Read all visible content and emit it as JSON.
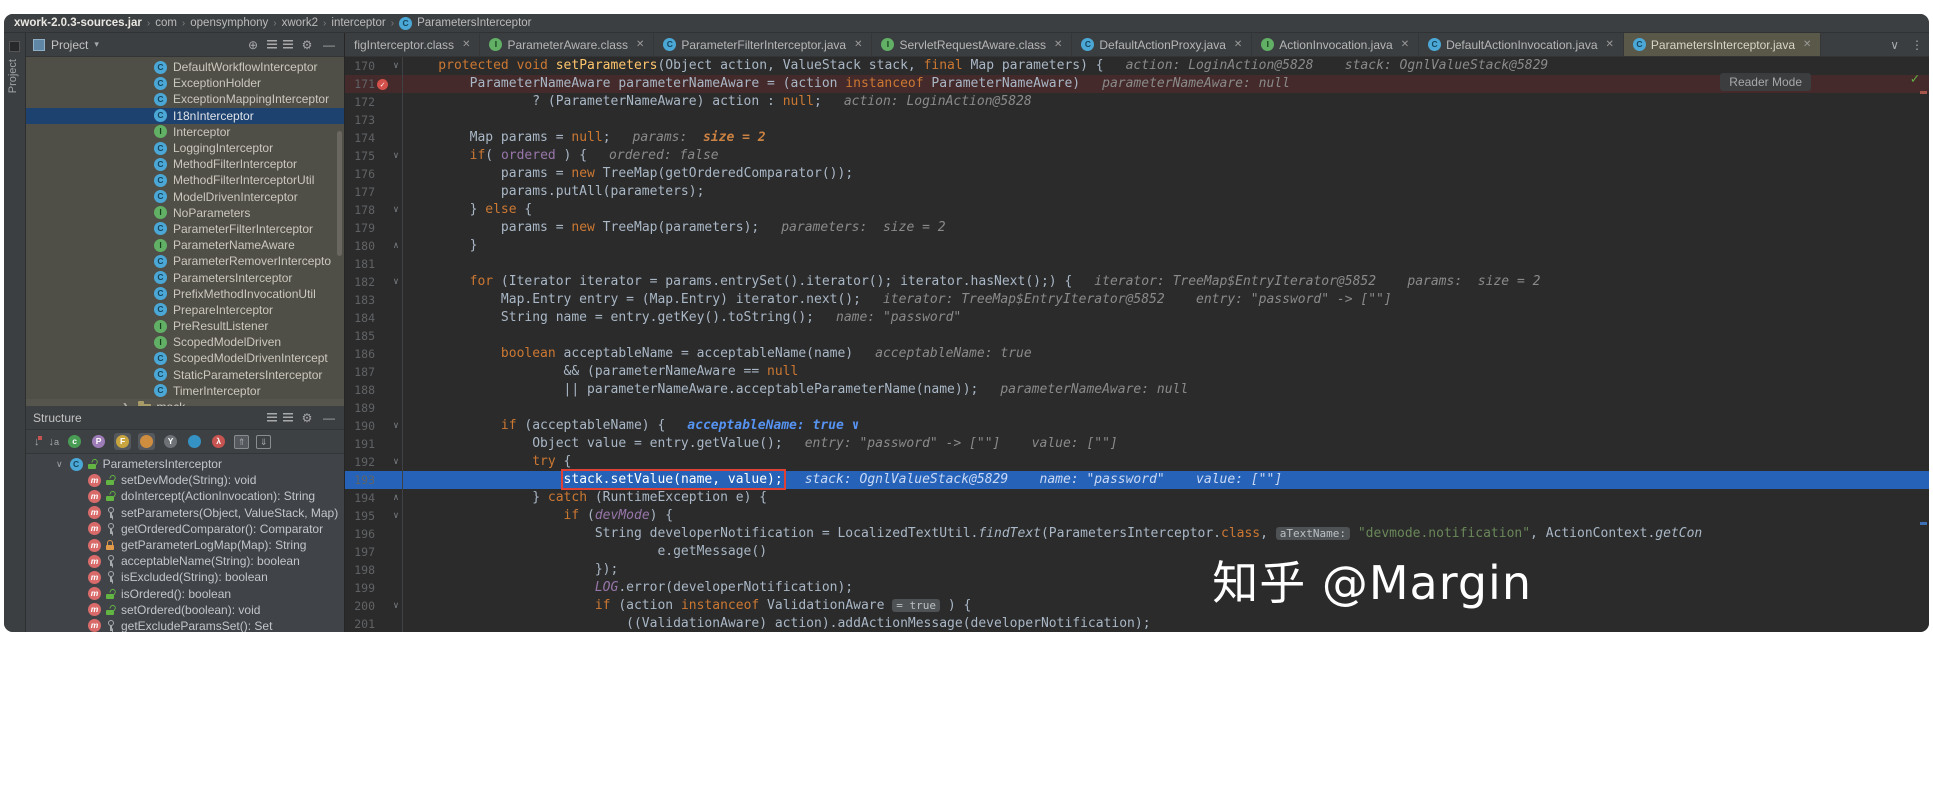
{
  "colors": {
    "editor_bg": "#2b2b2b",
    "panel_bg": "#3c3f41",
    "project_tree_bg": "#504f47",
    "selection_blue": "#1d4270",
    "execution_line": "#2663b8",
    "breakpoint_line": "#442a2a",
    "breakpoint_red": "#d3514a",
    "annotation_red": "#e03f34",
    "keyword_orange": "#cc7832",
    "string_green": "#6a8759",
    "hint_gray": "#8a8a8a",
    "hint_blue": "#5693f2",
    "check_green": "#62b543"
  },
  "breadcrumb": {
    "items": [
      "xwork-2.0.3-sources.jar",
      "com",
      "opensymphony",
      "xwork2",
      "interceptor",
      "ParametersInterceptor"
    ]
  },
  "window": {
    "reader_mode": "Reader Mode",
    "watermark": "知乎 @Margin"
  },
  "project_panel": {
    "tool_label": "Project",
    "title": "Project",
    "mock_folder": "mock",
    "items": [
      {
        "label": "DefaultWorkflowInterceptor",
        "icon": "class"
      },
      {
        "label": "ExceptionHolder",
        "icon": "class"
      },
      {
        "label": "ExceptionMappingInterceptor",
        "icon": "class"
      },
      {
        "label": "I18nInterceptor",
        "icon": "class",
        "selected": true
      },
      {
        "label": "Interceptor",
        "icon": "interface"
      },
      {
        "label": "LoggingInterceptor",
        "icon": "class"
      },
      {
        "label": "MethodFilterInterceptor",
        "icon": "class"
      },
      {
        "label": "MethodFilterInterceptorUtil",
        "icon": "class"
      },
      {
        "label": "ModelDrivenInterceptor",
        "icon": "class"
      },
      {
        "label": "NoParameters",
        "icon": "interface"
      },
      {
        "label": "ParameterFilterInterceptor",
        "icon": "class"
      },
      {
        "label": "ParameterNameAware",
        "icon": "interface"
      },
      {
        "label": "ParameterRemoverIntercepto",
        "icon": "class"
      },
      {
        "label": "ParametersInterceptor",
        "icon": "class"
      },
      {
        "label": "PrefixMethodInvocationUtil",
        "icon": "class"
      },
      {
        "label": "PrepareInterceptor",
        "icon": "class"
      },
      {
        "label": "PreResultListener",
        "icon": "interface"
      },
      {
        "label": "ScopedModelDriven",
        "icon": "interface"
      },
      {
        "label": "ScopedModelDrivenIntercept",
        "icon": "class"
      },
      {
        "label": "StaticParametersInterceptor",
        "icon": "class"
      },
      {
        "label": "TimerInterceptor",
        "icon": "class"
      }
    ]
  },
  "structure_panel": {
    "title": "Structure",
    "root": "ParametersInterceptor",
    "items": [
      {
        "label": "setDevMode(String): void",
        "visibility": "public"
      },
      {
        "label": "doIntercept(ActionInvocation): String",
        "visibility": "public"
      },
      {
        "label": "setParameters(Object, ValueStack, Map)",
        "visibility": "protected"
      },
      {
        "label": "getOrderedComparator(): Comparator",
        "visibility": "protected"
      },
      {
        "label": "getParameterLogMap(Map): String",
        "visibility": "private"
      },
      {
        "label": "acceptableName(String): boolean",
        "visibility": "protected"
      },
      {
        "label": "isExcluded(String): boolean",
        "visibility": "protected"
      },
      {
        "label": "isOrdered(): boolean",
        "visibility": "public"
      },
      {
        "label": "setOrdered(boolean): void",
        "visibility": "public"
      },
      {
        "label": "getExcludeParamsSet(): Set",
        "visibility": "protected"
      }
    ]
  },
  "tabs": {
    "items": [
      {
        "label": "figInterceptor.class",
        "icon": null
      },
      {
        "label": "ParameterAware.class",
        "icon": "interface"
      },
      {
        "label": "ParameterFilterInterceptor.java",
        "icon": "class"
      },
      {
        "label": "ServletRequestAware.class",
        "icon": "interface"
      },
      {
        "label": "DefaultActionProxy.java",
        "icon": "class"
      },
      {
        "label": "ActionInvocation.java",
        "icon": "interface"
      },
      {
        "label": "DefaultActionInvocation.java",
        "icon": "class"
      },
      {
        "label": "ParametersInterceptor.java",
        "icon": "class",
        "active": true
      }
    ]
  },
  "editor": {
    "lines": [
      {
        "n": 170,
        "fold": "v",
        "code": [
          [
            "k",
            "    protected void "
          ],
          [
            "m",
            "setParameters"
          ],
          [
            "d",
            "(Object action, ValueStack stack, "
          ],
          [
            "k",
            "final"
          ],
          [
            "d",
            " Map parameters) {"
          ]
        ],
        "hint": [
          [
            "h",
            "action: LoginAction@5828"
          ],
          [
            "h",
            "    stack: OgnlValueStack@5829"
          ]
        ]
      },
      {
        "n": 171,
        "bg": "bp",
        "bp": true,
        "code": [
          [
            "d",
            "        ParameterNameAware parameterNameAware = (action "
          ],
          [
            "k",
            "instanceof"
          ],
          [
            "d",
            " ParameterNameAware)"
          ]
        ],
        "hint": [
          [
            "h",
            "parameterNameAware: null"
          ]
        ]
      },
      {
        "n": 172,
        "code": [
          [
            "d",
            "                ? (ParameterNameAware) action : "
          ],
          [
            "k",
            "null"
          ],
          [
            "d",
            ";"
          ]
        ],
        "hint": [
          [
            "h",
            "action: LoginAction@5828"
          ]
        ]
      },
      {
        "n": 173,
        "code": []
      },
      {
        "n": 174,
        "code": [
          [
            "d",
            "        Map params = "
          ],
          [
            "k",
            "null"
          ],
          [
            "d",
            ";"
          ]
        ],
        "hint": [
          [
            "h",
            "params:  "
          ],
          [
            "hv",
            "size = 2"
          ]
        ]
      },
      {
        "n": 175,
        "fold": "v",
        "code": [
          [
            "d",
            "        "
          ],
          [
            "k",
            "if"
          ],
          [
            "d",
            "( "
          ],
          [
            "f",
            "ordered"
          ],
          [
            "d",
            " ) {"
          ]
        ],
        "hint": [
          [
            "h",
            "ordered: false"
          ]
        ]
      },
      {
        "n": 176,
        "code": [
          [
            "d",
            "            params = "
          ],
          [
            "k",
            "new"
          ],
          [
            "d",
            " TreeMap(getOrderedComparator());"
          ]
        ]
      },
      {
        "n": 177,
        "code": [
          [
            "d",
            "            params.putAll(parameters);"
          ]
        ]
      },
      {
        "n": 178,
        "fold": "v",
        "code": [
          [
            "d",
            "        } "
          ],
          [
            "k",
            "else"
          ],
          [
            "d",
            " {"
          ]
        ]
      },
      {
        "n": 179,
        "code": [
          [
            "d",
            "            params = "
          ],
          [
            "k",
            "new"
          ],
          [
            "d",
            " TreeMap(parameters);"
          ]
        ],
        "hint": [
          [
            "h",
            "parameters:  size = 2"
          ]
        ]
      },
      {
        "n": 180,
        "fold": "^",
        "code": [
          [
            "d",
            "        }"
          ]
        ]
      },
      {
        "n": 181,
        "code": []
      },
      {
        "n": 182,
        "fold": "v",
        "code": [
          [
            "d",
            "        "
          ],
          [
            "k",
            "for"
          ],
          [
            "d",
            " (Iterator iterator = params.entrySet().iterator(); iterator.hasNext();) {"
          ]
        ],
        "hint": [
          [
            "h",
            "iterator: TreeMap$EntryIterator@5852"
          ],
          [
            "h",
            "    params:  size = 2"
          ]
        ]
      },
      {
        "n": 183,
        "code": [
          [
            "d",
            "            Map.Entry entry = (Map.Entry) iterator.next();"
          ]
        ],
        "hint": [
          [
            "h",
            "iterator: TreeMap$EntryIterator@5852"
          ],
          [
            "h",
            "    entry: \"password\" -> [\"\"]"
          ]
        ]
      },
      {
        "n": 184,
        "code": [
          [
            "d",
            "            String name = entry.getKey().toString();"
          ]
        ],
        "hint": [
          [
            "h",
            "name: \"password\""
          ]
        ]
      },
      {
        "n": 185,
        "code": []
      },
      {
        "n": 186,
        "code": [
          [
            "d",
            "            "
          ],
          [
            "k",
            "boolean"
          ],
          [
            "d",
            " acceptableName = acceptableName(name)"
          ]
        ],
        "hint": [
          [
            "h",
            "acceptableName: true"
          ]
        ]
      },
      {
        "n": 187,
        "code": [
          [
            "d",
            "                    && (parameterNameAware == "
          ],
          [
            "k",
            "null"
          ]
        ]
      },
      {
        "n": 188,
        "code": [
          [
            "d",
            "                    || parameterNameAware.acceptableParameterName(name));"
          ]
        ],
        "hint": [
          [
            "h",
            "parameterNameAware: null"
          ]
        ]
      },
      {
        "n": 189,
        "code": []
      },
      {
        "n": 190,
        "fold": "v",
        "code": [
          [
            "d",
            "            "
          ],
          [
            "k",
            "if"
          ],
          [
            "d",
            " (acceptableName) {"
          ]
        ],
        "hint": [
          [
            "hb",
            "acceptableName: true ∨"
          ]
        ]
      },
      {
        "n": 191,
        "code": [
          [
            "d",
            "                Object value = entry.getValue();"
          ]
        ],
        "hint": [
          [
            "h",
            "entry: \"password\" -> [\"\"]"
          ],
          [
            "h",
            "    value: [\"\"]"
          ]
        ]
      },
      {
        "n": 192,
        "fold": "v",
        "code": [
          [
            "d",
            "                "
          ],
          [
            "k",
            "try"
          ],
          [
            "d",
            " {"
          ]
        ]
      },
      {
        "n": 193,
        "bg": "exec",
        "pre": "                    ",
        "box": [
          [
            "d",
            "stack.setValue(name, value);"
          ]
        ],
        "code": [],
        "hint": [
          [
            "h",
            "stack: OgnlValueStack@5829"
          ],
          [
            "h",
            "    name: \"password\""
          ],
          [
            "h",
            "    value: [\"\"]"
          ]
        ]
      },
      {
        "n": 194,
        "fold": "^",
        "code": [
          [
            "d",
            "                } "
          ],
          [
            "k",
            "catch"
          ],
          [
            "d",
            " (RuntimeException e) {"
          ]
        ]
      },
      {
        "n": 195,
        "fold": "v",
        "code": [
          [
            "d",
            "                    "
          ],
          [
            "k",
            "if"
          ],
          [
            "d",
            " ("
          ],
          [
            "fi",
            "devMode"
          ],
          [
            "d",
            ") {"
          ]
        ]
      },
      {
        "n": 196,
        "code": [
          [
            "d",
            "                        String developerNotification = LocalizedTextUtil."
          ],
          [
            "i",
            "findText"
          ],
          [
            "d",
            "(ParametersInterceptor."
          ],
          [
            "k",
            "class"
          ],
          [
            "d",
            ", "
          ],
          [
            "c",
            "aTextName:"
          ],
          [
            "d",
            " "
          ],
          [
            "s",
            "\"devmode.notification\""
          ],
          [
            "d",
            ", ActionContext."
          ],
          [
            "i",
            "getCon"
          ]
        ]
      },
      {
        "n": 197,
        "code": [
          [
            "d",
            "                                e.getMessage()"
          ]
        ]
      },
      {
        "n": 198,
        "code": [
          [
            "d",
            "                        });"
          ]
        ]
      },
      {
        "n": 199,
        "code": [
          [
            "d",
            "                        "
          ],
          [
            "fi",
            "LOG"
          ],
          [
            "d",
            ".error(developerNotification);"
          ]
        ]
      },
      {
        "n": 200,
        "fold": "v",
        "code": [
          [
            "d",
            "                        "
          ],
          [
            "k",
            "if"
          ],
          [
            "d",
            " (action "
          ],
          [
            "k",
            "instanceof"
          ],
          [
            "d",
            " ValidationAware "
          ],
          [
            "c",
            "= true"
          ],
          [
            "d",
            " ) {"
          ]
        ]
      },
      {
        "n": 201,
        "code": [
          [
            "d",
            "                            ((ValidationAware) action).addActionMessage(developerNotification);"
          ]
        ]
      }
    ]
  }
}
